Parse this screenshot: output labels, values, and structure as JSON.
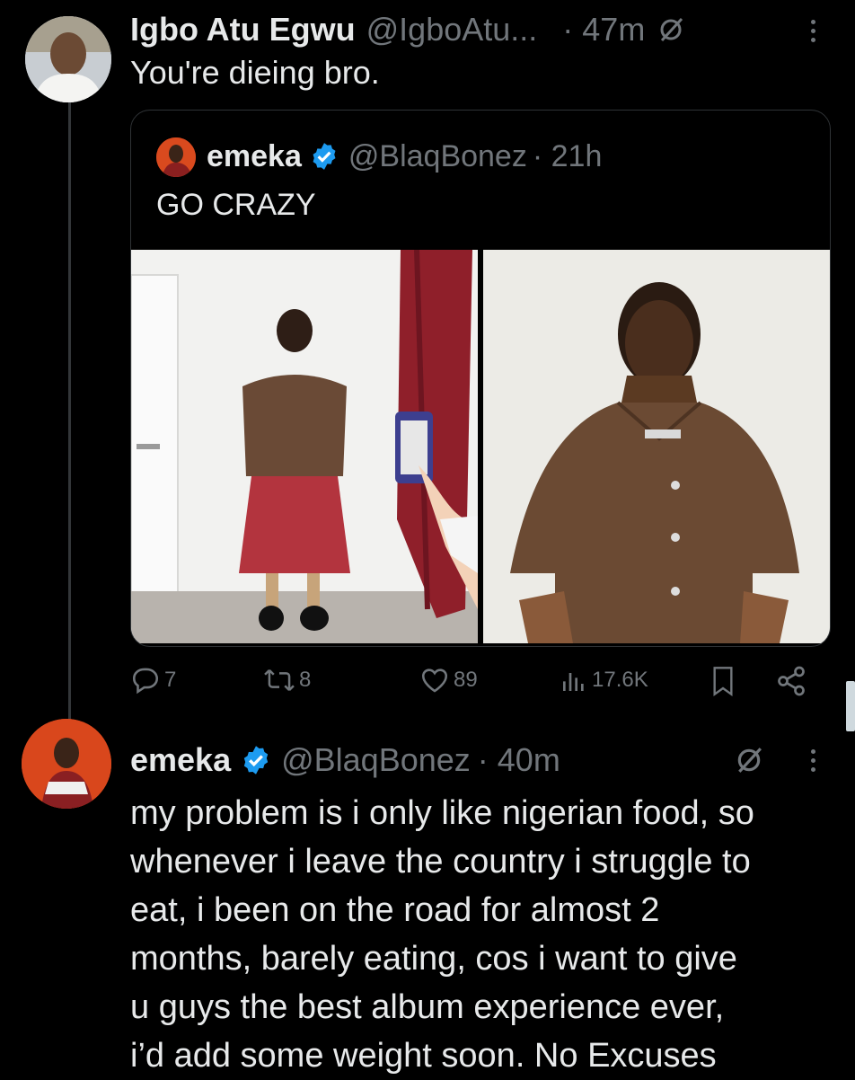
{
  "reply": {
    "display_name": "Igbo Atu Egwu",
    "handle": "@IgboAtu...",
    "time": "· 47m",
    "text": "You're dieing bro."
  },
  "quoted_tweet": {
    "display_name": "emeka",
    "handle": "@BlaqBonez",
    "time": "· 21h",
    "text": "GO CRAZY"
  },
  "actions": {
    "replies": "7",
    "reposts": "8",
    "likes": "89",
    "views": "17.6K"
  },
  "main_tweet": {
    "display_name": "emeka",
    "handle": "@BlaqBonez",
    "time": "· 40m",
    "lines": [
      "my problem is i only like nigerian food, so",
      "whenever i leave the country i struggle to",
      "eat, i been on the road for almost 2",
      "months, barely eating, cos i want to give",
      "u guys the best album experience ever,",
      "i’d add some weight soon. No Excuses"
    ]
  },
  "colors": {
    "background": "#000000",
    "text_primary": "#e7e9ea",
    "text_secondary": "#71767b",
    "verified_badge": "#1d9bf0",
    "border": "#2f3336"
  },
  "icons": [
    "grok-icon",
    "more-icon",
    "verified-icon",
    "reply-icon",
    "repost-icon",
    "like-icon",
    "views-icon",
    "bookmark-icon",
    "share-icon"
  ]
}
